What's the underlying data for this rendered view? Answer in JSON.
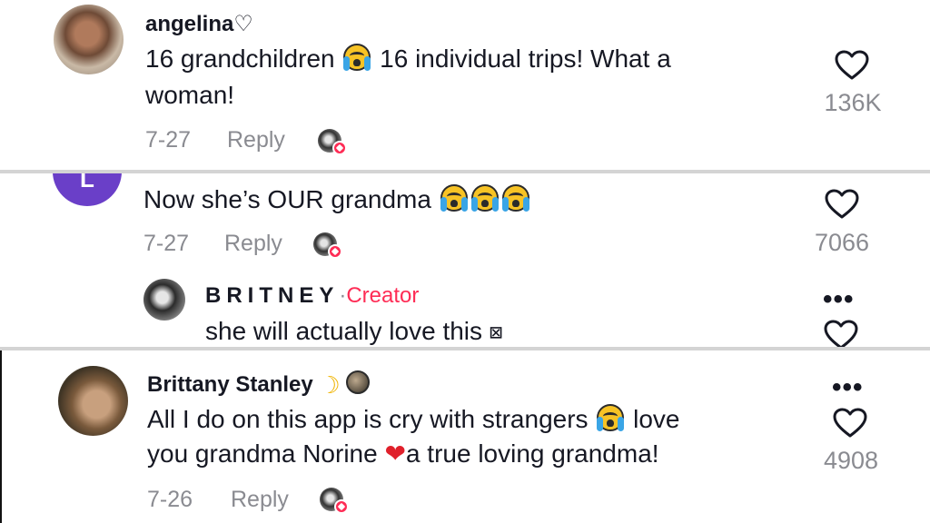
{
  "comments": [
    {
      "username": "angelina♡",
      "line1_a": "16 grandchildren",
      "line1_b": "16 individual trips! What a",
      "line2": "woman!",
      "date": "7-27",
      "reply_label": "Reply",
      "likes": "136K",
      "avatar_icon": "dog-photo-avatar"
    },
    {
      "avatar_letter": "L",
      "text": "Now she’s OUR grandma",
      "date": "7-27",
      "reply_label": "Reply",
      "likes": "7066",
      "reply": {
        "username": "BRITNEY",
        "separator": "·",
        "badge": "Creator",
        "text": "she will actually love this",
        "glyph": "⊠"
      }
    },
    {
      "username": "Brittany Stanley",
      "line1_a": "All I do on this app is cry with strangers",
      "line1_b": "love",
      "line2_a": "you grandma Norine",
      "line2_b": "a true loving grandma!",
      "date": "7-26",
      "reply_label": "Reply",
      "likes": "4908"
    }
  ],
  "icons": {
    "like": "heart-outline-icon",
    "more": "more-dots-icon",
    "creator_liked": "creator-liked-avatar-icon",
    "emoji_crying": "loudly-crying-face-emoji",
    "emoji_heart": "red-heart-emoji",
    "emoji_moon": "crescent-moon-emoji",
    "emoji_planet": "planet-emoji"
  },
  "colors": {
    "text": "#161823",
    "muted": "#8a8b91",
    "creator": "#fe2c55",
    "avatar_purple": "#6a3fc8"
  }
}
